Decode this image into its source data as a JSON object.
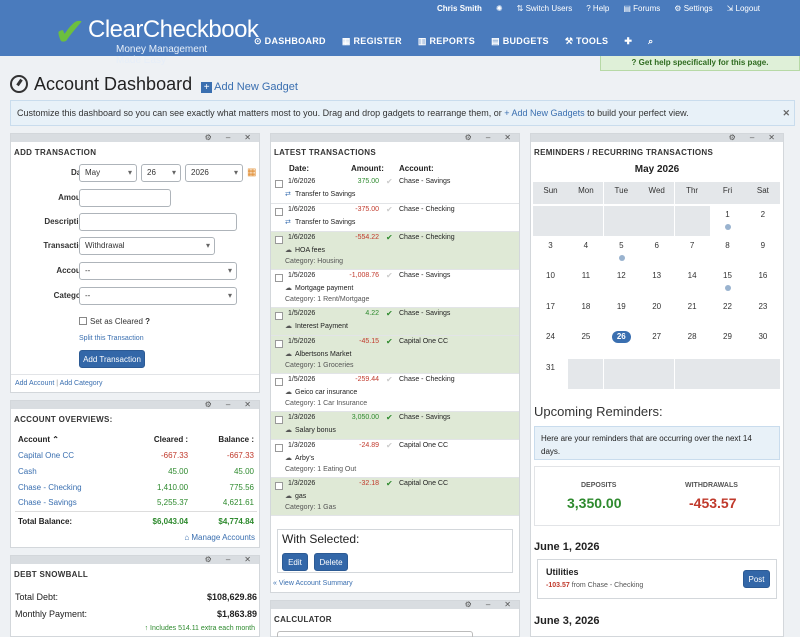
{
  "topbar": {
    "logo_text": "ClearCheckbook",
    "tagline": "Money Management Made Easy",
    "user": "Chris Smith",
    "links": [
      "Switch Users",
      "Help",
      "Forums",
      "Settings",
      "Logout"
    ],
    "nav": [
      "DASHBOARD",
      "REGISTER",
      "REPORTS",
      "BUDGETS",
      "TOOLS"
    ],
    "help_banner": "Get help specifically for this page."
  },
  "page": {
    "title": "Account Dashboard",
    "add_gadget": "Add New Gadget",
    "info_pre": "Customize this dashboard so you can see exactly what matters most to you. Drag and drop gadgets to rearrange them, or",
    "info_link": "+ Add New Gadgets",
    "info_post": "to build your perfect view."
  },
  "add_transaction": {
    "title": "ADD TRANSACTION",
    "date_label": "Date:",
    "month": "May",
    "day": "26",
    "year": "2026",
    "amount_label": "Amount:",
    "description_label": "Description:",
    "transaction_label": "Transaction:",
    "transaction_value": "Withdrawal",
    "account_label": "Account:",
    "account_value": "--",
    "category_label": "Category:",
    "category_value": "--",
    "set_cleared": "Set as Cleared",
    "split": "Split this Transaction",
    "submit": "Add Transaction",
    "footer_add_account": "Add Account",
    "footer_sep": "|",
    "footer_add_category": "Add Category"
  },
  "overviews": {
    "title": "ACCOUNT OVERVIEWS:",
    "col_account": "Account",
    "col_cleared": "Cleared :",
    "col_balance": "Balance :",
    "rows": [
      {
        "name": "Capital One CC",
        "cleared": "-667.33",
        "balance": "-667.33"
      },
      {
        "name": "Cash",
        "cleared": "45.00",
        "balance": "45.00"
      },
      {
        "name": "Chase - Checking",
        "cleared": "1,410.00",
        "balance": "775.56"
      },
      {
        "name": "Chase - Savings",
        "cleared": "5,255.37",
        "balance": "4,621.61"
      }
    ],
    "total_label": "Total Balance:",
    "total_cleared": "$6,043.04",
    "total_balance": "$4,774.84",
    "manage": "Manage Accounts"
  },
  "debt": {
    "title": "DEBT SNOWBALL",
    "total_label": "Total Debt:",
    "total_value": "$108,629.86",
    "monthly_label": "Monthly Payment:",
    "monthly_value": "$1,863.89",
    "extra": "Includes 514.11 extra each month"
  },
  "latest": {
    "title": "LATEST TRANSACTIONS",
    "col_date": "Date:",
    "col_amount": "Amount:",
    "col_account": "Account:",
    "rows": [
      {
        "date": "1/6/2026",
        "amount": "375.00",
        "account": "Chase - Savings",
        "desc": "Transfer to Savings",
        "cat": "",
        "cleared": false,
        "sign": "pos",
        "transfer": true
      },
      {
        "date": "1/6/2026",
        "amount": "-375.00",
        "account": "Chase - Checking",
        "desc": "Transfer to Savings",
        "cat": "",
        "cleared": false,
        "sign": "neg",
        "transfer": true
      },
      {
        "date": "1/6/2026",
        "amount": "-554.22",
        "account": "Chase - Checking",
        "desc": "HOA fees",
        "cat": "Category: Housing",
        "cleared": true,
        "sign": "neg",
        "transfer": false
      },
      {
        "date": "1/5/2026",
        "amount": "-1,008.76",
        "account": "Chase - Savings",
        "desc": "Mortgage payment",
        "cat": "Category: 1 Rent/Mortgage",
        "cleared": false,
        "sign": "neg",
        "transfer": false
      },
      {
        "date": "1/5/2026",
        "amount": "4.22",
        "account": "Chase - Savings",
        "desc": "Interest Payment",
        "cat": "",
        "cleared": true,
        "sign": "pos",
        "transfer": false
      },
      {
        "date": "1/5/2026",
        "amount": "-45.15",
        "account": "Capital One CC",
        "desc": "Albertsons Market",
        "cat": "Category: 1 Groceries",
        "cleared": true,
        "sign": "neg",
        "transfer": false
      },
      {
        "date": "1/5/2026",
        "amount": "-259.44",
        "account": "Chase - Checking",
        "desc": "Geico car insurance",
        "cat": "Category: 1 Car Insurance",
        "cleared": false,
        "sign": "neg",
        "transfer": false
      },
      {
        "date": "1/3/2026",
        "amount": "3,050.00",
        "account": "Chase - Savings",
        "desc": "Salary bonus",
        "cat": "",
        "cleared": true,
        "sign": "pos",
        "transfer": false
      },
      {
        "date": "1/3/2026",
        "amount": "-24.89",
        "account": "Capital One CC",
        "desc": "Arby's",
        "cat": "Category: 1 Eating Out",
        "cleared": false,
        "sign": "neg",
        "transfer": false
      },
      {
        "date": "1/3/2026",
        "amount": "-32.18",
        "account": "Capital One CC",
        "desc": "gas",
        "cat": "Category: 1 Gas",
        "cleared": true,
        "sign": "neg",
        "transfer": false
      }
    ],
    "with_selected": "With Selected:",
    "edit": "Edit",
    "delete": "Delete",
    "view_summary": "« View Account Summary"
  },
  "calculator": {
    "title": "CALCULATOR"
  },
  "reminders": {
    "title": "REMINDERS / RECURRING TRANSACTIONS",
    "month": "May 2026",
    "weekdays": [
      "Sun",
      "Mon",
      "Tue",
      "Wed",
      "Thr",
      "Fri",
      "Sat"
    ],
    "days": [
      [
        "",
        "",
        "",
        "",
        "",
        "1",
        "2"
      ],
      [
        "3",
        "4",
        "5",
        "6",
        "7",
        "8",
        "9"
      ],
      [
        "10",
        "11",
        "12",
        "13",
        "14",
        "15",
        "16"
      ],
      [
        "17",
        "18",
        "19",
        "20",
        "21",
        "22",
        "23"
      ],
      [
        "24",
        "25",
        "26",
        "27",
        "28",
        "29",
        "30"
      ],
      [
        "31",
        "",
        "",
        "",
        "",
        "",
        ""
      ]
    ],
    "dots": [
      "1",
      "5",
      "15"
    ],
    "today": "26",
    "upcoming_title": "Upcoming Reminders:",
    "upcoming_note": "Here are your reminders that are occurring over the next 14 days.",
    "deposits_label": "DEPOSITS",
    "deposits_value": "3,350.00",
    "withdrawals_label": "WITHDRAWALS",
    "withdrawals_value": "-453.57",
    "date1": "June 1, 2026",
    "item_name": "Utilities",
    "item_amount": "-103.57",
    "item_from": "from Chase - Checking",
    "post": "Post",
    "date2": "June 3, 2026"
  },
  "colors": {
    "brand": "#4a7bbd",
    "cleared_row": "#dfe9d6",
    "green": "#2e8a2e",
    "red": "#c0392b"
  }
}
